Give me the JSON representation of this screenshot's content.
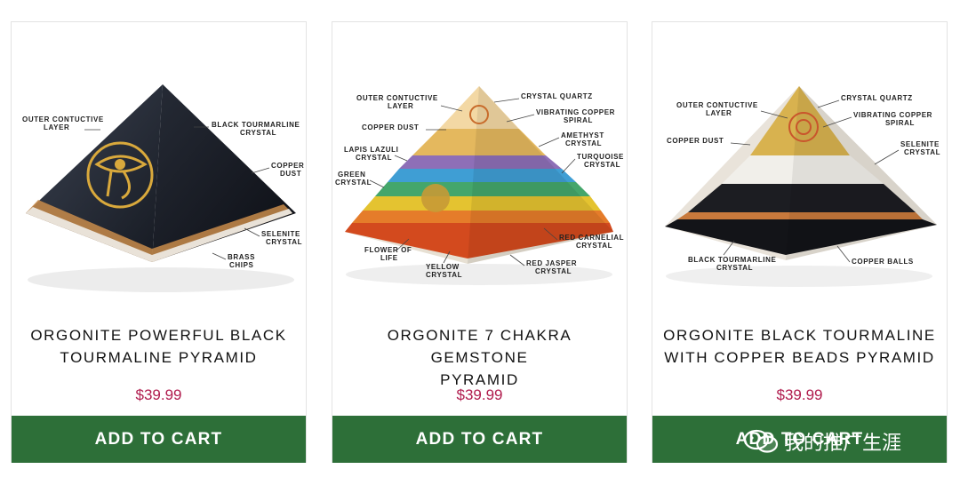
{
  "products": [
    {
      "title_line1": "ORGONITE POWERFUL BLACK",
      "title_line2": "TOURMALINE PYRAMID",
      "price": "$39.99",
      "cart_label": "ADD TO CART",
      "callouts": {
        "outer_layer": [
          "OUTER CONTUCTIVE",
          "LAYER"
        ],
        "black_tourmaline": [
          "BLACK TOURMARLINE",
          "CRYSTAL"
        ],
        "copper_dust": [
          "COPPER",
          "DUST"
        ],
        "selenite": [
          "SELENITE",
          "CRYSTAL"
        ],
        "brass_chips": [
          "BRASS",
          "CHIPS"
        ]
      }
    },
    {
      "title_line1": "ORGONITE 7 CHAKRA GEMSTONE",
      "title_line2": "PYRAMID",
      "price": "$39.99",
      "cart_label": "ADD TO CART",
      "callouts": {
        "outer_layer": [
          "OUTER CONTUCTIVE",
          "LAYER"
        ],
        "crystal_quartz": [
          "CRYSTAL QUARTZ"
        ],
        "copper_dust": [
          "COPPER DUST"
        ],
        "vibrating_copper": [
          "VIBRATING COPPER",
          "SPIRAL"
        ],
        "amethyst": [
          "AMETHYST",
          "CRYSTAL"
        ],
        "lapis": [
          "LAPIS LAZULI",
          "CRYSTAL"
        ],
        "turquoise": [
          "TURQUOISE",
          "CRYSTAL"
        ],
        "green": [
          "GREEN",
          "CRYSTAL"
        ],
        "red_carnelial": [
          "RED CARNELIAL",
          "CRYSTAL"
        ],
        "flower": [
          "FLOWER OF",
          "LIFE"
        ],
        "red_jasper": [
          "RED JASPER",
          "CRYSTAL"
        ],
        "yellow": [
          "YELLOW",
          "CRYSTAL"
        ]
      }
    },
    {
      "title_line1": "ORGONITE BLACK TOURMALINE",
      "title_line2": "WITH COPPER BEADS PYRAMID",
      "price": "$39.99",
      "cart_label": "ADD TO CART",
      "callouts": {
        "outer_layer": [
          "OUTER CONTUCTIVE",
          "LAYER"
        ],
        "crystal_quartz": [
          "CRYSTAL QUARTZ"
        ],
        "vibrating_copper": [
          "VIBRATING COPPER",
          "SPIRAL"
        ],
        "copper_dust": [
          "COPPER DUST"
        ],
        "selenite": [
          "SELENITE",
          "CRYSTAL"
        ],
        "black_tourmaline": [
          "BLACK TOURMARLINE",
          "CRYSTAL"
        ],
        "copper_balls": [
          "COPPER BALLS"
        ]
      }
    }
  ],
  "watermark": {
    "text": "我的推广生涯"
  },
  "colors": {
    "cart_green": "#2d6f38",
    "price_red": "#b01b4d"
  }
}
